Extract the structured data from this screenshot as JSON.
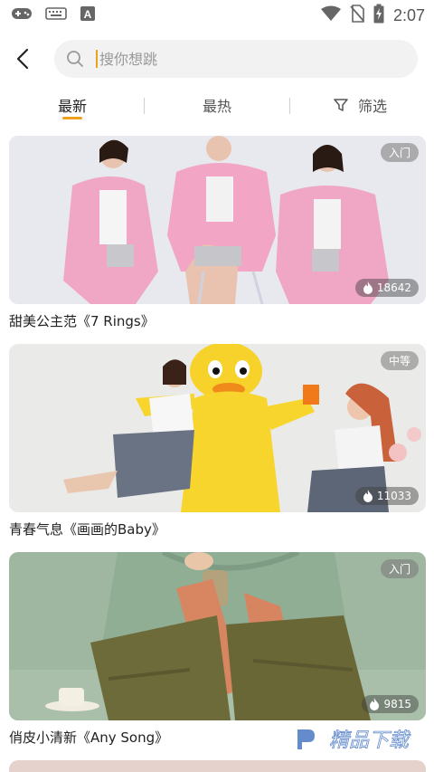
{
  "status_bar": {
    "time": "2:07",
    "icons": [
      "gamepad-icon",
      "keyboard-icon",
      "font-a-icon",
      "wifi-icon",
      "no-sim-icon",
      "battery-charging-icon"
    ],
    "font_a_glyph": "A"
  },
  "header": {
    "back_icon": "chevron-left-icon",
    "search": {
      "placeholder": "搜你想跳"
    }
  },
  "tabs": {
    "items": [
      {
        "label": "最新",
        "active": true
      },
      {
        "label": "最热",
        "active": false
      },
      {
        "label": "筛选",
        "active": false,
        "icon": "filter-icon"
      }
    ],
    "accent": "#f0a020"
  },
  "videos": [
    {
      "level": "入门",
      "heat": "18642",
      "title": "甜美公主范《7 Rings》"
    },
    {
      "level": "中等",
      "heat": "11033",
      "title": "青春气息《画画的Baby》"
    },
    {
      "level": "入门",
      "heat": "9815",
      "title": "俏皮小清新《Any Song》"
    }
  ],
  "watermark": {
    "text": "精品下载"
  }
}
